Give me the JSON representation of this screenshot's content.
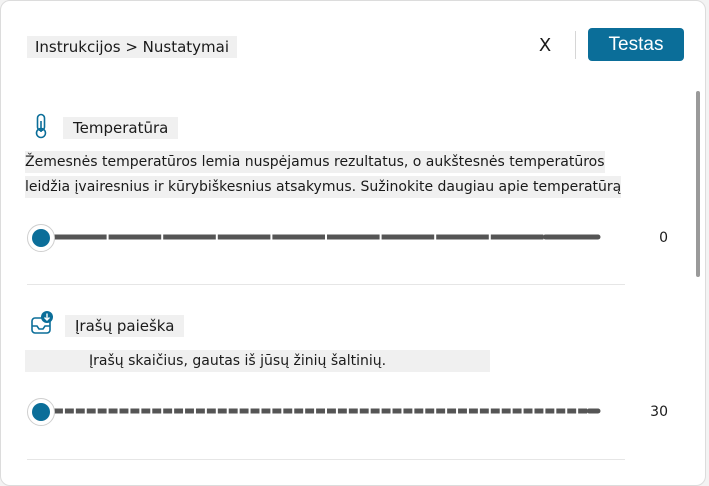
{
  "header": {
    "breadcrumb": "Instrukcijos > Nustatymai",
    "close_label": "X",
    "test_label": "Testas"
  },
  "temperature": {
    "icon": "thermometer-icon",
    "label": "Temperatūra",
    "desc_line1": "Žemesnės temperatūros lemia nuspėjamus rezultatus, o aukštesnės temperatūros",
    "desc_line2": "leidžia įvairesnius ir kūrybiškesnius atsakymus. Sužinokite daugiau apie temperatūrą",
    "value": "0",
    "slider_fraction": 0,
    "tick_count": 10
  },
  "record_search": {
    "icon": "inbox-download-icon",
    "label": "Įrašų paieška",
    "desc": "Įrašų skaičius, gautas iš jūsų žinių šaltinių.",
    "value": "30",
    "slider_fraction": 0,
    "tick_count": 50
  },
  "colors": {
    "accent": "#0b6e99",
    "track": "#555555"
  }
}
